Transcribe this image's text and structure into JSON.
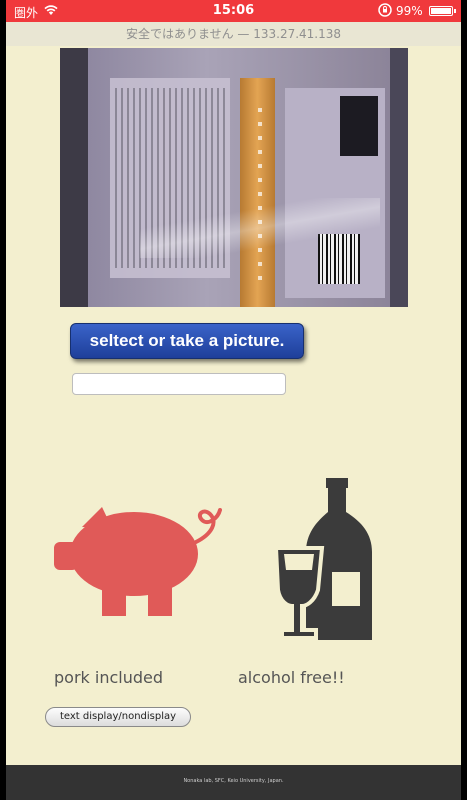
{
  "status_bar": {
    "carrier": "圏外",
    "time": "15:06",
    "battery_percent": "99%",
    "battery_level": 0.99,
    "icons": [
      "wifi-icon",
      "orientation-lock-icon",
      "battery-icon"
    ]
  },
  "url_bar": {
    "text": "安全ではありません — 133.27.41.138"
  },
  "upload": {
    "button_label": "seltect or take a picture.",
    "file_field_value": ""
  },
  "results": {
    "pork_icon": "pig-icon",
    "pork_label": "pork included",
    "pork_color": "#e05a58",
    "alcohol_icon": "wine-bottle-glass-icon",
    "alcohol_label": "alcohol free!!",
    "alcohol_color": "#3b3b3b"
  },
  "toggle": {
    "label": "text display/nondisplay"
  },
  "footer": {
    "text": "Nonaka lab, SFC, Keio University, Japan."
  },
  "colors": {
    "background": "#f3efcf",
    "status_bar": "#f0393c",
    "button_blue": "#2a4fb4",
    "footer": "#333333"
  }
}
